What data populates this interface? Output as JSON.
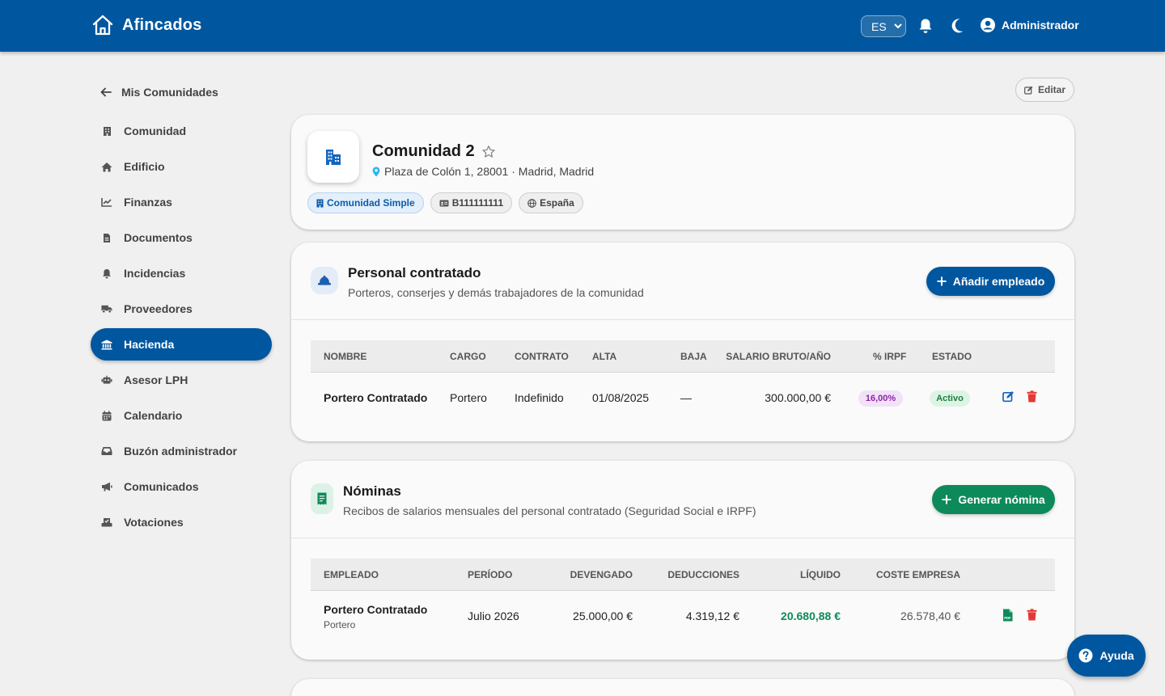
{
  "app": {
    "title": "Afincados",
    "language": "ES",
    "user_name": "Administrador"
  },
  "sidebar": {
    "back_label": "Mis Comunidades",
    "items": [
      {
        "label": "Comunidad",
        "icon": "building-icon"
      },
      {
        "label": "Edificio",
        "icon": "home-icon"
      },
      {
        "label": "Finanzas",
        "icon": "chart-line-icon"
      },
      {
        "label": "Documentos",
        "icon": "document-icon"
      },
      {
        "label": "Incidencias",
        "icon": "bell-icon"
      },
      {
        "label": "Proveedores",
        "icon": "truck-icon"
      },
      {
        "label": "Hacienda",
        "icon": "bank-icon"
      },
      {
        "label": "Asesor LPH",
        "icon": "robot-icon"
      },
      {
        "label": "Calendario",
        "icon": "calendar-icon"
      },
      {
        "label": "Buzón administrador",
        "icon": "inbox-icon"
      },
      {
        "label": "Comunicados",
        "icon": "megaphone-icon"
      },
      {
        "label": "Votaciones",
        "icon": "ballot-icon"
      }
    ],
    "active_item": "Hacienda"
  },
  "edit_label": "Editar",
  "community": {
    "name": "Comunidad 2",
    "address": "Plaza de Colón 1, 28001 · Madrid, Madrid",
    "chips": {
      "type": "Comunidad Simple",
      "cif": "B111111111",
      "country": "España"
    }
  },
  "staff": {
    "title": "Personal contratado",
    "subtitle": "Porteros, conserjes y demás trabajadores de la comunidad",
    "add_label": "Añadir empleado",
    "columns": [
      "NOMBRE",
      "CARGO",
      "CONTRATO",
      "ALTA",
      "BAJA",
      "SALARIO BRUTO/AÑO",
      "% IRPF",
      "ESTADO"
    ],
    "rows": [
      {
        "name": "Portero Contratado",
        "role": "Portero",
        "contract": "Indefinido",
        "start": "01/08/2025",
        "end": "—",
        "salary": "300.000,00 €",
        "irpf": "16,00%",
        "status": "Activo"
      }
    ]
  },
  "payroll": {
    "title": "Nóminas",
    "subtitle": "Recibos de salarios mensuales del personal contratado (Seguridad Social e IRPF)",
    "generate_label": "Generar nómina",
    "columns": [
      "EMPLEADO",
      "PERÍODO",
      "DEVENGADO",
      "DEDUCCIONES",
      "LÍQUIDO",
      "COSTE EMPRESA"
    ],
    "rows": [
      {
        "employee": "Portero Contratado",
        "role": "Portero",
        "period": "Julio 2026",
        "accrued": "25.000,00 €",
        "deductions": "4.319,12 €",
        "net": "20.680,88 €",
        "company_cost": "26.578,40 €"
      }
    ]
  },
  "help_label": "Ayuda",
  "colors": {
    "primary": "#00579f",
    "payroll_green": "#0d8a5a",
    "danger": "#e53935",
    "irpf_badge": "#f1e2f8",
    "status_badge": "#ddf3e4"
  }
}
